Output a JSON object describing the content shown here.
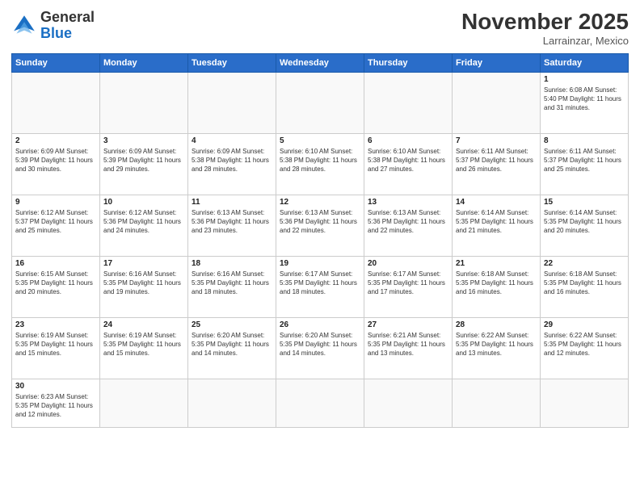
{
  "logo": {
    "text_general": "General",
    "text_blue": "Blue"
  },
  "header": {
    "month_year": "November 2025",
    "location": "Larrainzar, Mexico"
  },
  "days_of_week": [
    "Sunday",
    "Monday",
    "Tuesday",
    "Wednesday",
    "Thursday",
    "Friday",
    "Saturday"
  ],
  "weeks": [
    [
      {
        "day": "",
        "info": ""
      },
      {
        "day": "",
        "info": ""
      },
      {
        "day": "",
        "info": ""
      },
      {
        "day": "",
        "info": ""
      },
      {
        "day": "",
        "info": ""
      },
      {
        "day": "",
        "info": ""
      },
      {
        "day": "1",
        "info": "Sunrise: 6:08 AM\nSunset: 5:40 PM\nDaylight: 11 hours\nand 31 minutes."
      }
    ],
    [
      {
        "day": "2",
        "info": "Sunrise: 6:09 AM\nSunset: 5:39 PM\nDaylight: 11 hours\nand 30 minutes."
      },
      {
        "day": "3",
        "info": "Sunrise: 6:09 AM\nSunset: 5:39 PM\nDaylight: 11 hours\nand 29 minutes."
      },
      {
        "day": "4",
        "info": "Sunrise: 6:09 AM\nSunset: 5:38 PM\nDaylight: 11 hours\nand 28 minutes."
      },
      {
        "day": "5",
        "info": "Sunrise: 6:10 AM\nSunset: 5:38 PM\nDaylight: 11 hours\nand 28 minutes."
      },
      {
        "day": "6",
        "info": "Sunrise: 6:10 AM\nSunset: 5:38 PM\nDaylight: 11 hours\nand 27 minutes."
      },
      {
        "day": "7",
        "info": "Sunrise: 6:11 AM\nSunset: 5:37 PM\nDaylight: 11 hours\nand 26 minutes."
      },
      {
        "day": "8",
        "info": "Sunrise: 6:11 AM\nSunset: 5:37 PM\nDaylight: 11 hours\nand 25 minutes."
      }
    ],
    [
      {
        "day": "9",
        "info": "Sunrise: 6:12 AM\nSunset: 5:37 PM\nDaylight: 11 hours\nand 25 minutes."
      },
      {
        "day": "10",
        "info": "Sunrise: 6:12 AM\nSunset: 5:36 PM\nDaylight: 11 hours\nand 24 minutes."
      },
      {
        "day": "11",
        "info": "Sunrise: 6:13 AM\nSunset: 5:36 PM\nDaylight: 11 hours\nand 23 minutes."
      },
      {
        "day": "12",
        "info": "Sunrise: 6:13 AM\nSunset: 5:36 PM\nDaylight: 11 hours\nand 22 minutes."
      },
      {
        "day": "13",
        "info": "Sunrise: 6:13 AM\nSunset: 5:36 PM\nDaylight: 11 hours\nand 22 minutes."
      },
      {
        "day": "14",
        "info": "Sunrise: 6:14 AM\nSunset: 5:35 PM\nDaylight: 11 hours\nand 21 minutes."
      },
      {
        "day": "15",
        "info": "Sunrise: 6:14 AM\nSunset: 5:35 PM\nDaylight: 11 hours\nand 20 minutes."
      }
    ],
    [
      {
        "day": "16",
        "info": "Sunrise: 6:15 AM\nSunset: 5:35 PM\nDaylight: 11 hours\nand 20 minutes."
      },
      {
        "day": "17",
        "info": "Sunrise: 6:16 AM\nSunset: 5:35 PM\nDaylight: 11 hours\nand 19 minutes."
      },
      {
        "day": "18",
        "info": "Sunrise: 6:16 AM\nSunset: 5:35 PM\nDaylight: 11 hours\nand 18 minutes."
      },
      {
        "day": "19",
        "info": "Sunrise: 6:17 AM\nSunset: 5:35 PM\nDaylight: 11 hours\nand 18 minutes."
      },
      {
        "day": "20",
        "info": "Sunrise: 6:17 AM\nSunset: 5:35 PM\nDaylight: 11 hours\nand 17 minutes."
      },
      {
        "day": "21",
        "info": "Sunrise: 6:18 AM\nSunset: 5:35 PM\nDaylight: 11 hours\nand 16 minutes."
      },
      {
        "day": "22",
        "info": "Sunrise: 6:18 AM\nSunset: 5:35 PM\nDaylight: 11 hours\nand 16 minutes."
      }
    ],
    [
      {
        "day": "23",
        "info": "Sunrise: 6:19 AM\nSunset: 5:35 PM\nDaylight: 11 hours\nand 15 minutes."
      },
      {
        "day": "24",
        "info": "Sunrise: 6:19 AM\nSunset: 5:35 PM\nDaylight: 11 hours\nand 15 minutes."
      },
      {
        "day": "25",
        "info": "Sunrise: 6:20 AM\nSunset: 5:35 PM\nDaylight: 11 hours\nand 14 minutes."
      },
      {
        "day": "26",
        "info": "Sunrise: 6:20 AM\nSunset: 5:35 PM\nDaylight: 11 hours\nand 14 minutes."
      },
      {
        "day": "27",
        "info": "Sunrise: 6:21 AM\nSunset: 5:35 PM\nDaylight: 11 hours\nand 13 minutes."
      },
      {
        "day": "28",
        "info": "Sunrise: 6:22 AM\nSunset: 5:35 PM\nDaylight: 11 hours\nand 13 minutes."
      },
      {
        "day": "29",
        "info": "Sunrise: 6:22 AM\nSunset: 5:35 PM\nDaylight: 11 hours\nand 12 minutes."
      }
    ],
    [
      {
        "day": "30",
        "info": "Sunrise: 6:23 AM\nSunset: 5:35 PM\nDaylight: 11 hours\nand 12 minutes."
      },
      {
        "day": "",
        "info": ""
      },
      {
        "day": "",
        "info": ""
      },
      {
        "day": "",
        "info": ""
      },
      {
        "day": "",
        "info": ""
      },
      {
        "day": "",
        "info": ""
      },
      {
        "day": "",
        "info": ""
      }
    ]
  ]
}
